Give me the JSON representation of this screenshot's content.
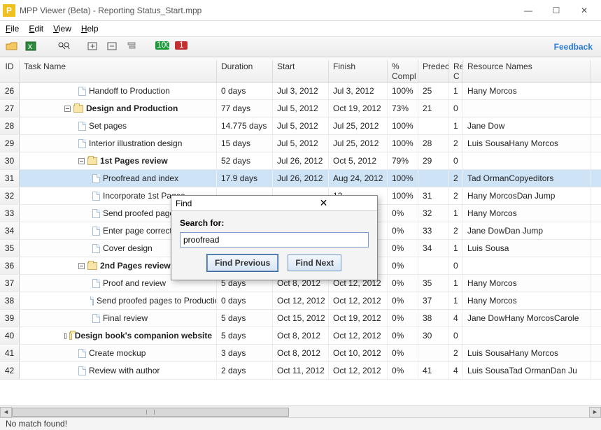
{
  "window": {
    "title": "MPP Viewer (Beta) - Reporting Status_Start.mpp"
  },
  "menubar": {
    "file": "File",
    "edit": "Edit",
    "view": "View",
    "help": "Help"
  },
  "toolbar": {
    "feedback": "Feedback"
  },
  "columns": {
    "id": "ID",
    "name": "Task Name",
    "duration": "Duration",
    "start": "Start",
    "finish": "Finish",
    "complete": "% Compl",
    "pred": "Predec",
    "rec": "Re C",
    "res": "Resource Names"
  },
  "rows": [
    {
      "id": "26",
      "indent": 3,
      "icon": "page",
      "name": "Handoff to Production",
      "dur": "0 days",
      "start": "Jul 3, 2012",
      "fin": "Jul 3, 2012",
      "comp": "100%",
      "pred": "25",
      "rec": "1",
      "res": "Hany Morcos"
    },
    {
      "id": "27",
      "indent": 2,
      "icon": "folder",
      "toggle": true,
      "bold": true,
      "name": "Design and Production",
      "dur": "77 days",
      "start": "Jul 5, 2012",
      "fin": "Oct 19, 2012",
      "comp": "73%",
      "pred": "21",
      "rec": "0",
      "res": ""
    },
    {
      "id": "28",
      "indent": 3,
      "icon": "page",
      "name": "Set pages",
      "dur": "14.775 days",
      "start": "Jul 5, 2012",
      "fin": "Jul 25, 2012",
      "comp": "100%",
      "pred": "",
      "rec": "1",
      "res": "Jane Dow"
    },
    {
      "id": "29",
      "indent": 3,
      "icon": "page",
      "name": "Interior illustration design",
      "dur": "15 days",
      "start": "Jul 5, 2012",
      "fin": "Jul 25, 2012",
      "comp": "100%",
      "pred": "28",
      "rec": "2",
      "res": "Luis SousaHany Morcos"
    },
    {
      "id": "30",
      "indent": 3,
      "icon": "folder",
      "toggle": true,
      "bold": true,
      "name": "1st Pages review",
      "dur": "52 days",
      "start": "Jul 26, 2012",
      "fin": "Oct 5, 2012",
      "comp": "79%",
      "pred": "29",
      "rec": "0",
      "res": ""
    },
    {
      "id": "31",
      "indent": 4,
      "icon": "page",
      "name": "Proofread and index",
      "dur": "17.9 days",
      "start": "Jul 26, 2012",
      "fin": "Aug 24, 2012",
      "comp": "100%",
      "pred": "",
      "rec": "2",
      "res": "Tad OrmanCopyeditors",
      "sel": true
    },
    {
      "id": "32",
      "indent": 4,
      "icon": "page",
      "name": "Incorporate 1st Pages",
      "dur": "",
      "start": "",
      "fin": "12",
      "comp": "100%",
      "pred": "31",
      "rec": "2",
      "res": "Hany MorcosDan Jump"
    },
    {
      "id": "33",
      "indent": 4,
      "icon": "page",
      "name": "Send proofed pages to",
      "dur": "",
      "start": "",
      "fin": "12",
      "comp": "0%",
      "pred": "32",
      "rec": "1",
      "res": "Hany Morcos"
    },
    {
      "id": "34",
      "indent": 4,
      "icon": "page",
      "name": "Enter page corrections",
      "dur": "",
      "start": "",
      "fin": "12",
      "comp": "0%",
      "pred": "33",
      "rec": "2",
      "res": "Jane DowDan Jump"
    },
    {
      "id": "35",
      "indent": 4,
      "icon": "page",
      "name": "Cover design",
      "dur": "",
      "start": "",
      "fin": "12",
      "comp": "0%",
      "pred": "34",
      "rec": "1",
      "res": "Luis Sousa"
    },
    {
      "id": "36",
      "indent": 3,
      "icon": "folder",
      "toggle": true,
      "bold": true,
      "name": "2nd Pages review",
      "dur": "",
      "start": "",
      "fin": "12",
      "comp": "0%",
      "pred": "",
      "rec": "0",
      "res": ""
    },
    {
      "id": "37",
      "indent": 4,
      "icon": "page",
      "name": "Proof and review",
      "dur": "5 days",
      "start": "Oct 8, 2012",
      "fin": "Oct 12, 2012",
      "comp": "0%",
      "pred": "35",
      "rec": "1",
      "res": "Hany Morcos"
    },
    {
      "id": "38",
      "indent": 4,
      "icon": "page",
      "name": "Send proofed pages to Production",
      "dur": "0 days",
      "start": "Oct 12, 2012",
      "fin": "Oct 12, 2012",
      "comp": "0%",
      "pred": "37",
      "rec": "1",
      "res": "Hany Morcos"
    },
    {
      "id": "39",
      "indent": 4,
      "icon": "page",
      "name": "Final review",
      "dur": "5 days",
      "start": "Oct 15, 2012",
      "fin": "Oct 19, 2012",
      "comp": "0%",
      "pred": "38",
      "rec": "4",
      "res": "Jane DowHany MorcosCarole"
    },
    {
      "id": "40",
      "indent": 2,
      "icon": "folder",
      "toggle": true,
      "bold": true,
      "name": "Design book's companion website",
      "dur": "5 days",
      "start": "Oct 8, 2012",
      "fin": "Oct 12, 2012",
      "comp": "0%",
      "pred": "30",
      "rec": "0",
      "res": ""
    },
    {
      "id": "41",
      "indent": 3,
      "icon": "page",
      "name": "Create mockup",
      "dur": "3 days",
      "start": "Oct 8, 2012",
      "fin": "Oct 10, 2012",
      "comp": "0%",
      "pred": "",
      "rec": "2",
      "res": "Luis SousaHany Morcos"
    },
    {
      "id": "42",
      "indent": 3,
      "icon": "page",
      "name": "Review with author",
      "dur": "2 days",
      "start": "Oct 11, 2012",
      "fin": "Oct 12, 2012",
      "comp": "0%",
      "pred": "41",
      "rec": "4",
      "res": "Luis SousaTad OrmanDan Ju"
    }
  ],
  "find": {
    "title": "Find",
    "label": "Search for:",
    "value": "proofread",
    "prev": "Find Previous",
    "next": "Find Next"
  },
  "status": {
    "text": "No match found!"
  }
}
